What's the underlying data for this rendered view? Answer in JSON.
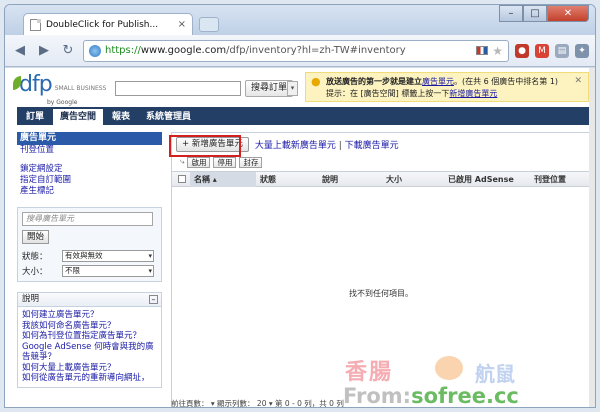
{
  "browser": {
    "tab_title": "DoubleClick for Publish...",
    "tab_close": "×",
    "url_scheme": "https://",
    "url_host": "www.google.com",
    "url_path": "/dfp/inventory?hl=zh-TW#inventory",
    "window_controls": {
      "min": "–",
      "max": "□",
      "close": "✕"
    }
  },
  "header": {
    "logo_text": "dfp",
    "logo_small": "SMALL BUSINESS",
    "by_google": "by Google",
    "search_button": "搜尋訂單",
    "search_drop": "▾"
  },
  "tip": {
    "line1_bold": "放送廣告的第一步就是建立",
    "line1_link": "廣告單元",
    "line1_rest": "。(在共 6 個廣告中排名第 1)",
    "line2_pre": "提示：在 [廣告空間] 標籤上按一下",
    "line2_link": "新增廣告單元",
    "close": "✕"
  },
  "nav": {
    "tabs": [
      {
        "label": "訂單"
      },
      {
        "label": "廣告空間"
      },
      {
        "label": "報表"
      },
      {
        "label": "系統管理員"
      }
    ],
    "active_index": 1
  },
  "sidebar": {
    "selected": "廣告單元",
    "links": [
      "刊登位置"
    ],
    "links2": [
      "鎖定網設定",
      "指定自訂範圍",
      "產生標記"
    ],
    "search_placeholder": "搜尋廣告單元",
    "search_button": "開始",
    "filters": [
      {
        "label": "狀態：",
        "value": "有效與無效"
      },
      {
        "label": "大小：",
        "value": "不限"
      }
    ],
    "help_title": "說明",
    "help_links": [
      "如何建立廣告單元？",
      "我該如何命名廣告單元？",
      "如何為刊登位置指定廣告單元？",
      "Google AdSense 何時會與我的廣告競爭？",
      "如何大量上載廣告單元？",
      "如何從廣告單元的重新導向網址，"
    ]
  },
  "main": {
    "new_button": "新增廣告單元",
    "bulk_upload": "大量上載新廣告單元",
    "download": "下載廣告單元",
    "row_buttons": [
      "啟用",
      "停用",
      "封存"
    ],
    "columns": [
      "名稱 ▴",
      "狀態",
      "說明",
      "大小",
      "已啟用 AdSense",
      "刊登位置"
    ],
    "empty_message": "找不到任何項目。",
    "pager": "前往頁數： ▾   顯示列數： 20 ▾   第 0 - 0 列，共 0 列"
  },
  "watermark": {
    "text1": "香腸",
    "text2": "航鼠",
    "text3_pre": "From:",
    "text3_brand": "sofree.cc"
  },
  "colors": {
    "nav_bar": "#243f66",
    "selected_item": "#2a5aa8",
    "link": "#1a1aa6",
    "highlight": "#d21f1f",
    "tip_bg": "#fcf3c1"
  }
}
